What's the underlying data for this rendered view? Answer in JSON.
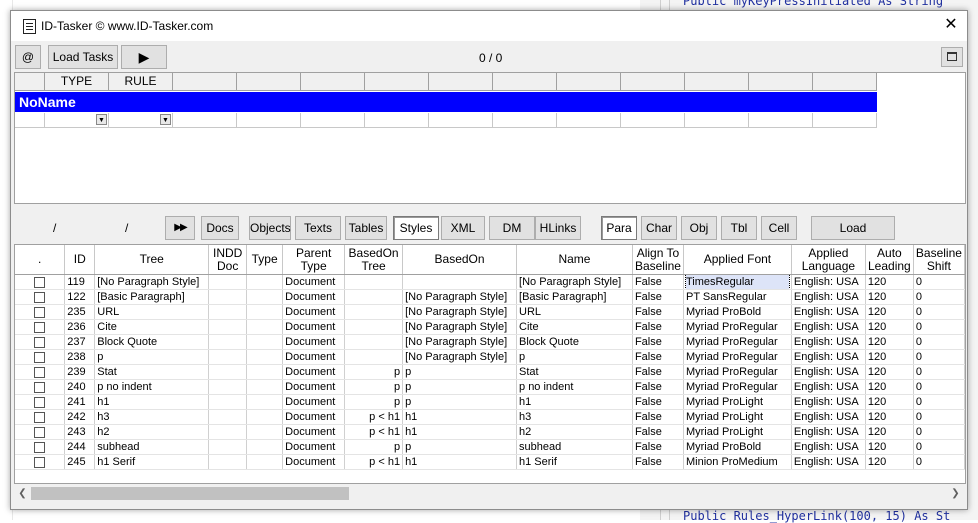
{
  "window": {
    "title": "ID-Tasker  © www.ID-Tasker.com",
    "counter": "0 / 0"
  },
  "toolbar": {
    "at_label": "@",
    "load_tasks": "Load Tasks",
    "play_label": "▶",
    "restore_label": "🗗"
  },
  "upper_grid": {
    "col_type": "TYPE",
    "col_rule": "RULE",
    "row_name": "NoName"
  },
  "nav": {
    "sep1": "/",
    "sep2": "/",
    "ff_label": "▶▶",
    "tabs": [
      "Docs",
      "Objects",
      "Texts",
      "Tables",
      "Styles",
      "XML",
      "DM",
      "HLinks"
    ],
    "subtabs": [
      "Para",
      "Char",
      "Obj",
      "Tbl",
      "Cell"
    ],
    "load": "Load"
  },
  "grid": {
    "headers": [
      ".",
      "ID",
      "Tree",
      "INDD Doc",
      "Type",
      "Parent Type",
      "BasedOn Tree",
      "BasedOn",
      "Name",
      "Align To Baseline",
      "Applied Font",
      "Applied Language",
      "Auto Leading",
      "Baseline Shift"
    ],
    "rows": [
      [
        "119",
        "[No Paragraph Style]",
        "",
        "",
        "Document",
        "",
        "",
        "[No Paragraph Style]",
        "False",
        "TimesRegular",
        "English: USA",
        "120",
        "0"
      ],
      [
        "122",
        "[Basic Paragraph]",
        "",
        "",
        "Document",
        "",
        "[No Paragraph Style]",
        "[Basic Paragraph]",
        "False",
        "PT SansRegular",
        "English: USA",
        "120",
        "0"
      ],
      [
        "235",
        "URL",
        "",
        "",
        "Document",
        "",
        "[No Paragraph Style]",
        "URL",
        "False",
        "Myriad ProBold",
        "English: USA",
        "120",
        "0"
      ],
      [
        "236",
        "Cite",
        "",
        "",
        "Document",
        "",
        "[No Paragraph Style]",
        "Cite",
        "False",
        "Myriad ProRegular",
        "English: USA",
        "120",
        "0"
      ],
      [
        "237",
        "Block Quote",
        "",
        "",
        "Document",
        "",
        "[No Paragraph Style]",
        "Block Quote",
        "False",
        "Myriad ProRegular",
        "English: USA",
        "120",
        "0"
      ],
      [
        "238",
        "p",
        "",
        "",
        "Document",
        "",
        "[No Paragraph Style]",
        "p",
        "False",
        "Myriad ProRegular",
        "English: USA",
        "120",
        "0"
      ],
      [
        "239",
        "Stat",
        "",
        "",
        "Document",
        "p",
        "p",
        "Stat",
        "False",
        "Myriad ProRegular",
        "English: USA",
        "120",
        "0"
      ],
      [
        "240",
        "p no indent",
        "",
        "",
        "Document",
        "p",
        "p",
        "p no indent",
        "False",
        "Myriad ProRegular",
        "English: USA",
        "120",
        "0"
      ],
      [
        "241",
        "h1",
        "",
        "",
        "Document",
        "p",
        "p",
        "h1",
        "False",
        "Myriad ProLight",
        "English: USA",
        "120",
        "0"
      ],
      [
        "242",
        "h3",
        "",
        "",
        "Document",
        "p < h1",
        "h1",
        "h3",
        "False",
        "Myriad ProLight",
        "English: USA",
        "120",
        "0"
      ],
      [
        "243",
        "h2",
        "",
        "",
        "Document",
        "p < h1",
        "h1",
        "h2",
        "False",
        "Myriad ProLight",
        "English: USA",
        "120",
        "0"
      ],
      [
        "244",
        "subhead",
        "",
        "",
        "Document",
        "p",
        "p",
        "subhead",
        "False",
        "Myriad ProBold",
        "English: USA",
        "120",
        "0"
      ],
      [
        "245",
        "h1 Serif",
        "",
        "",
        "Document",
        "p < h1",
        "h1",
        "h1 Serif",
        "False",
        "Minion ProMedium",
        "English: USA",
        "120",
        "0"
      ]
    ]
  },
  "background": {
    "code_top": "Public myKeyPressInitiated As String",
    "code_bottom": "Public Rules_HyperLink(100, 15) As St"
  },
  "colors": {
    "selection_blue": "#0000ff",
    "window_bg": "#f0f0f0"
  }
}
